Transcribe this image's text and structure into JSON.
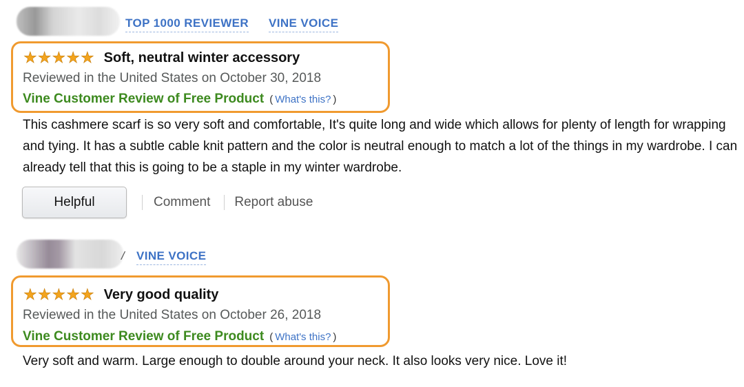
{
  "reviews": [
    {
      "badges": [
        "TOP 1000 REVIEWER",
        "VINE VOICE"
      ],
      "rating_stars": 5,
      "title": "Soft, neutral winter accessory",
      "meta": "Reviewed in the United States on October 30, 2018",
      "vine_label": "Vine Customer Review of Free Product",
      "paren_open": "(",
      "whats_this": "What's this?",
      "paren_close": ")",
      "body": "This cashmere scarf is so very soft and comfortable, It's quite long and wide which allows for plenty of length for wrapping and tying. It has a subtle cable knit pattern and the color is neutral enough to match a lot of the things in my wardrobe. I can already tell that this is going to be a staple in my winter wardrobe.",
      "actions": {
        "helpful": "Helpful",
        "comment": "Comment",
        "report": "Report abuse"
      }
    },
    {
      "badge_separator": "/",
      "badges": [
        "VINE VOICE"
      ],
      "rating_stars": 5,
      "title": "Very good quality",
      "meta": "Reviewed in the United States on October 26, 2018",
      "vine_label": "Vine Customer Review of Free Product",
      "paren_open": "(",
      "whats_this": "What's this?",
      "paren_close": ")",
      "body": "Very soft and warm. Large enough to double around your neck. It also looks very nice. Love it!"
    }
  ],
  "icons": {
    "star": "star-icon",
    "avatar": "blurred-avatar"
  },
  "colors": {
    "highlight_border": "#f09a2f",
    "star": "#f3a41e",
    "badge_link": "#3d72c5",
    "vine_green": "#3d8a1f",
    "meta_gray": "#565959"
  }
}
